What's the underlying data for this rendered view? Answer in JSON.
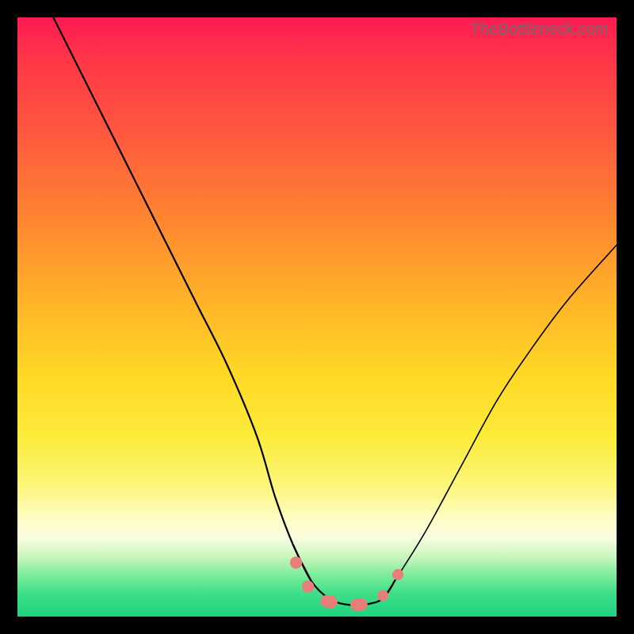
{
  "watermark": "TheBottleneck.com",
  "chart_data": {
    "type": "line",
    "title": "",
    "xlabel": "",
    "ylabel": "",
    "xlim": [
      0,
      100
    ],
    "ylim": [
      0,
      100
    ],
    "series": [
      {
        "name": "curve",
        "x": [
          6,
          10,
          15,
          20,
          25,
          30,
          35,
          40,
          43,
          46,
          49,
          52,
          55,
          58,
          61,
          63,
          68,
          74,
          80,
          86,
          92,
          100
        ],
        "y": [
          100,
          92,
          82,
          72,
          62,
          52,
          42,
          30,
          20,
          12,
          6,
          3,
          2,
          2,
          3,
          6,
          14,
          25,
          36,
          45,
          53,
          62
        ]
      }
    ],
    "markers": {
      "name": "bottom-blobs",
      "points": [
        {
          "x": 46.5,
          "y": 9,
          "r": 2.4
        },
        {
          "x": 48.5,
          "y": 5,
          "r": 2.4
        },
        {
          "x": 52,
          "y": 2.5,
          "r": 3.6,
          "elongate": true
        },
        {
          "x": 57,
          "y": 2,
          "r": 3.6,
          "elongate": true
        },
        {
          "x": 61,
          "y": 3.5,
          "r": 2.2
        },
        {
          "x": 63.5,
          "y": 7,
          "r": 2.2
        }
      ]
    },
    "background_gradient": {
      "stops": [
        {
          "pos": 0,
          "color": "#ff1a52"
        },
        {
          "pos": 50,
          "color": "#ffd926"
        },
        {
          "pos": 85,
          "color": "#fefdc8"
        },
        {
          "pos": 100,
          "color": "#1dd37f"
        }
      ]
    }
  }
}
